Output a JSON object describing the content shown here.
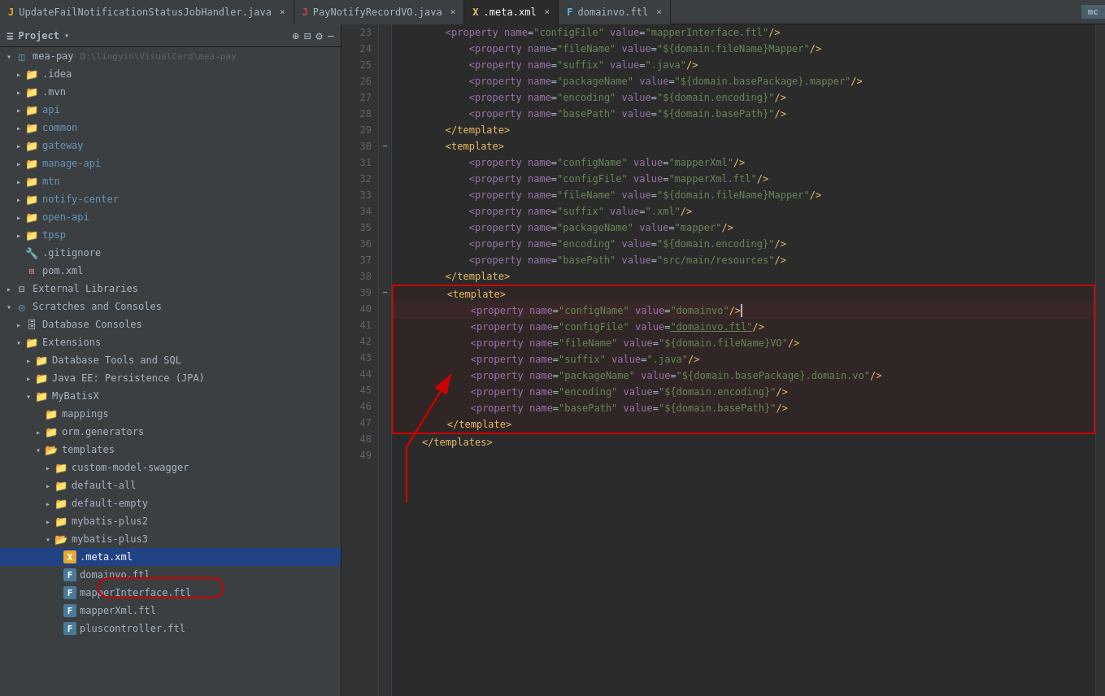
{
  "tabs": [
    {
      "id": "tab1",
      "label": "UpdateFailNotificationStatusJobHandler.java",
      "icon": "java",
      "active": false,
      "closeable": true
    },
    {
      "id": "tab2",
      "label": "PayNotifyRecordVO.java",
      "icon": "java",
      "active": false,
      "closeable": true
    },
    {
      "id": "tab3",
      "label": ".meta.xml",
      "icon": "xml",
      "active": true,
      "closeable": true
    },
    {
      "id": "tab4",
      "label": "domainvo.ftl",
      "icon": "ftl",
      "active": false,
      "closeable": true
    }
  ],
  "sidebar": {
    "title": "Project",
    "root": {
      "label": "mea-pay",
      "path": "D:\\lingyin\\VisualCard\\mea-pay"
    }
  },
  "tree": [
    {
      "id": "mea-pay",
      "label": "mea-pay",
      "path": "D:\\lingyin\\VisualCard\\mea-pay",
      "indent": 0,
      "type": "module",
      "expanded": true
    },
    {
      "id": "idea",
      "label": ".idea",
      "indent": 1,
      "type": "folder-closed",
      "expanded": false
    },
    {
      "id": "mvn",
      "label": ".mvn",
      "indent": 1,
      "type": "folder-closed",
      "expanded": false
    },
    {
      "id": "api",
      "label": "api",
      "indent": 1,
      "type": "folder-blue",
      "expanded": false
    },
    {
      "id": "common",
      "label": "common",
      "indent": 1,
      "type": "folder-blue",
      "expanded": false
    },
    {
      "id": "gateway",
      "label": "gateway",
      "indent": 1,
      "type": "folder-blue",
      "expanded": false
    },
    {
      "id": "manage-api",
      "label": "manage-api",
      "indent": 1,
      "type": "folder-blue",
      "expanded": false
    },
    {
      "id": "mtn",
      "label": "mtn",
      "indent": 1,
      "type": "folder-blue",
      "expanded": false
    },
    {
      "id": "notify-center",
      "label": "notify-center",
      "indent": 1,
      "type": "folder-blue",
      "expanded": false
    },
    {
      "id": "open-api",
      "label": "open-api",
      "indent": 1,
      "type": "folder-blue",
      "expanded": false
    },
    {
      "id": "tpsp",
      "label": "tpsp",
      "indent": 1,
      "type": "folder-blue",
      "expanded": false
    },
    {
      "id": "gitignore",
      "label": ".gitignore",
      "indent": 1,
      "type": "git"
    },
    {
      "id": "pom",
      "label": "pom.xml",
      "indent": 1,
      "type": "pom"
    },
    {
      "id": "ext-libs",
      "label": "External Libraries",
      "indent": 0,
      "type": "ext-libs",
      "expanded": false
    },
    {
      "id": "scratches",
      "label": "Scratches and Consoles",
      "indent": 0,
      "type": "scratches",
      "expanded": true
    },
    {
      "id": "db-consoles",
      "label": "Database Consoles",
      "indent": 1,
      "type": "db-consoles",
      "expanded": false
    },
    {
      "id": "extensions",
      "label": "Extensions",
      "indent": 1,
      "type": "folder-closed",
      "expanded": true
    },
    {
      "id": "db-tools",
      "label": "Database Tools and SQL",
      "indent": 2,
      "type": "folder-closed",
      "expanded": false
    },
    {
      "id": "jpa",
      "label": "Java EE: Persistence (JPA)",
      "indent": 2,
      "type": "folder-closed",
      "expanded": false
    },
    {
      "id": "mybatisx",
      "label": "MyBatisX",
      "indent": 2,
      "type": "folder-closed",
      "expanded": true
    },
    {
      "id": "mappings",
      "label": "mappings",
      "indent": 3,
      "type": "folder-closed"
    },
    {
      "id": "orm-generators",
      "label": "orm.generators",
      "indent": 3,
      "type": "folder-closed",
      "expanded": false
    },
    {
      "id": "templates",
      "label": "templates",
      "indent": 3,
      "type": "folder-open",
      "expanded": true
    },
    {
      "id": "custom-model-swagger",
      "label": "custom-model-swagger",
      "indent": 4,
      "type": "folder-closed",
      "expanded": false
    },
    {
      "id": "default-all",
      "label": "default-all",
      "indent": 4,
      "type": "folder-closed",
      "expanded": false
    },
    {
      "id": "default-empty",
      "label": "default-empty",
      "indent": 4,
      "type": "folder-closed",
      "expanded": false
    },
    {
      "id": "mybatis-plus2",
      "label": "mybatis-plus2",
      "indent": 4,
      "type": "folder-closed",
      "expanded": false
    },
    {
      "id": "mybatis-plus3",
      "label": "mybatis-plus3",
      "indent": 4,
      "type": "folder-open",
      "expanded": true
    },
    {
      "id": "meta-xml",
      "label": ".meta.xml",
      "indent": 5,
      "type": "meta-xml",
      "selected": true
    },
    {
      "id": "domainvo-ftl",
      "label": "domainvo.ftl",
      "indent": 5,
      "type": "ftl"
    },
    {
      "id": "mapperInterface-ftl",
      "label": "mapperInterface.ftl",
      "indent": 5,
      "type": "ftl"
    },
    {
      "id": "mapperXml-ftl",
      "label": "mapperXml.ftl",
      "indent": 5,
      "type": "ftl"
    },
    {
      "id": "pluscontroller-ftl",
      "label": "pluscontroller.ftl",
      "indent": 5,
      "type": "ftl"
    }
  ],
  "code_lines": [
    {
      "num": 23,
      "indent": 2,
      "content": "<property name=\"configFile\" value=\"mapperInterface.ftl\"/>",
      "type": "property"
    },
    {
      "num": 24,
      "indent": 3,
      "content": "<property name=\"fileName\" value=\"${domain.fileName}Mapper\"/>",
      "type": "property"
    },
    {
      "num": 25,
      "indent": 3,
      "content": "<property name=\"suffix\" value=\".java\"/>",
      "type": "property"
    },
    {
      "num": 26,
      "indent": 3,
      "content": "<property name=\"packageName\" value=\"${domain.basePackage}.mapper\"/>",
      "type": "property"
    },
    {
      "num": 27,
      "indent": 3,
      "content": "<property name=\"encoding\" value=\"${domain.encoding}\"/>",
      "type": "property"
    },
    {
      "num": 28,
      "indent": 3,
      "content": "<property name=\"basePath\" value=\"${domain.basePath}\"/>",
      "type": "property"
    },
    {
      "num": 29,
      "indent": 2,
      "content": "</template>",
      "type": "close-tag"
    },
    {
      "num": 30,
      "indent": 2,
      "content": "<template>",
      "type": "open-tag",
      "fold": true
    },
    {
      "num": 31,
      "indent": 3,
      "content": "<property name=\"configName\" value=\"mapperXml\"/>",
      "type": "property"
    },
    {
      "num": 32,
      "indent": 3,
      "content": "<property name=\"configFile\" value=\"mapperXml.ftl\"/>",
      "type": "property"
    },
    {
      "num": 33,
      "indent": 3,
      "content": "<property name=\"fileName\" value=\"${domain.fileName}Mapper\"/>",
      "type": "property"
    },
    {
      "num": 34,
      "indent": 3,
      "content": "<property name=\"suffix\" value=\".xml\"/>",
      "type": "property"
    },
    {
      "num": 35,
      "indent": 3,
      "content": "<property name=\"packageName\" value=\"mapper\"/>",
      "type": "property"
    },
    {
      "num": 36,
      "indent": 3,
      "content": "<property name=\"encoding\" value=\"${domain.encoding}\"/>",
      "type": "property"
    },
    {
      "num": 37,
      "indent": 3,
      "content": "<property name=\"basePath\" value=\"src/main/resources\"/>",
      "type": "property"
    },
    {
      "num": 38,
      "indent": 2,
      "content": "</template>",
      "type": "close-tag"
    },
    {
      "num": 39,
      "indent": 2,
      "content": "<template>",
      "type": "open-tag",
      "fold": true,
      "highlight_start": true
    },
    {
      "num": 40,
      "indent": 3,
      "content": "<property name=\"configName\" value=\"domainvo\"/>",
      "type": "property",
      "highlight": true
    },
    {
      "num": 41,
      "indent": 3,
      "content": "<property name=\"configFile\" value=\"domainvo.ftl\"/>",
      "type": "property",
      "highlight": true
    },
    {
      "num": 42,
      "indent": 3,
      "content": "<property name=\"fileName\" value=\"${domain.fileName}VO\"/>",
      "type": "property",
      "highlight": true
    },
    {
      "num": 43,
      "indent": 3,
      "content": "<property name=\"suffix\" value=\".java\"/>",
      "type": "property",
      "highlight": true
    },
    {
      "num": 44,
      "indent": 3,
      "content": "<property name=\"packageName\" value=\"${domain.basePackage}.domain.vo\"/>",
      "type": "property",
      "highlight": true
    },
    {
      "num": 45,
      "indent": 3,
      "content": "<property name=\"encoding\" value=\"${domain.encoding}\"/>",
      "type": "property",
      "highlight": true
    },
    {
      "num": 46,
      "indent": 3,
      "content": "<property name=\"basePath\" value=\"${domain.basePath}\"/>",
      "type": "property",
      "highlight": true
    },
    {
      "num": 47,
      "indent": 2,
      "content": "</template>",
      "type": "close-tag",
      "highlight_end": true
    },
    {
      "num": 48,
      "indent": 1,
      "content": "</templates>",
      "type": "close-tag"
    },
    {
      "num": 49,
      "indent": 0,
      "content": "",
      "type": "empty"
    }
  ],
  "icons": {
    "arrow_right": "▸",
    "arrow_down": "▾",
    "folder": "📁",
    "close": "×",
    "project_icon": "≡",
    "gear": "⚙",
    "plus": "+",
    "minus": "−",
    "settings": "⚙"
  }
}
